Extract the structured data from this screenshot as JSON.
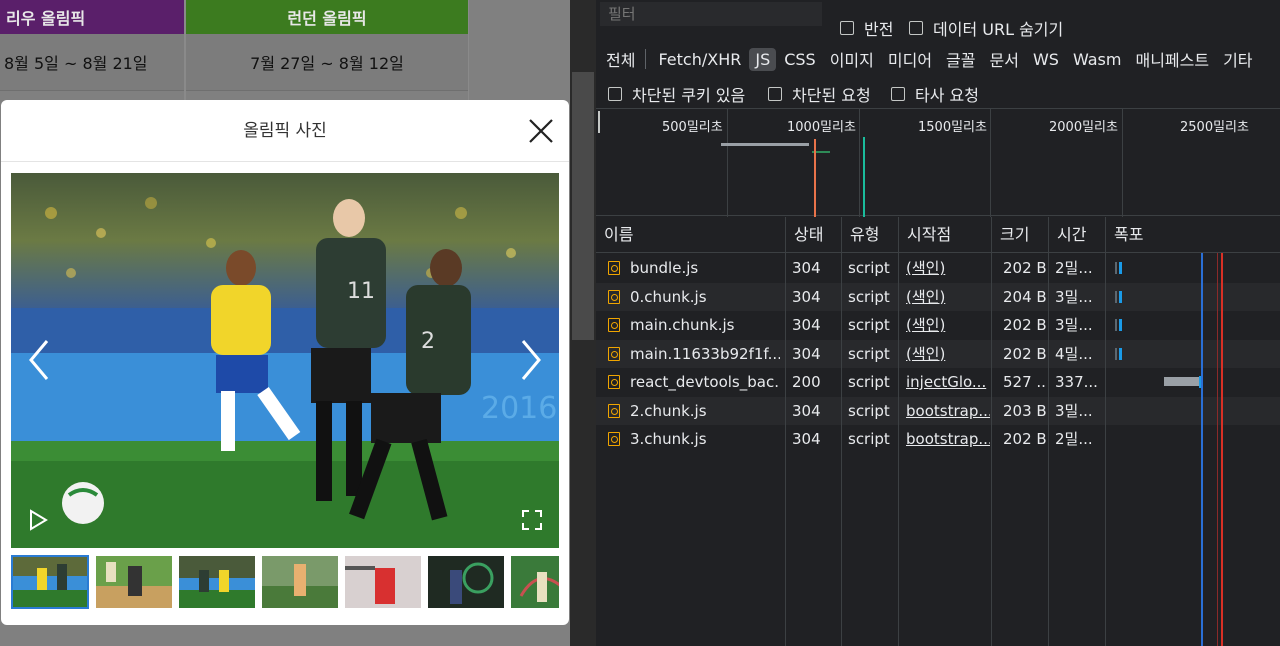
{
  "olympics": {
    "rio": {
      "title": "리우 올림픽",
      "dates": "8월 5일 ~ 8월 21일"
    },
    "london": {
      "title": "런던 올림픽",
      "dates": "7월 27일 ~ 8월 12일"
    }
  },
  "modal": {
    "title": "올림픽 사진",
    "thumbnail_count": 7,
    "active_thumbnail": 1
  },
  "devtools": {
    "filter_placeholder": "필터",
    "invert_label": "반전",
    "hide_data_urls_label": "데이터 URL 숨기기",
    "types": [
      "전체",
      "Fetch/XHR",
      "JS",
      "CSS",
      "이미지",
      "미디어",
      "글꼴",
      "문서",
      "WS",
      "Wasm",
      "매니페스트",
      "기타"
    ],
    "active_type": "JS",
    "blocked_cookies_label": "차단된 쿠키 있음",
    "blocked_requests_label": "차단된 요청",
    "third_party_label": "타사 요청",
    "timeline_labels": [
      "500밀리초",
      "1000밀리초",
      "1500밀리초",
      "2000밀리초",
      "2500밀리초"
    ],
    "columns": [
      "이름",
      "상태",
      "유형",
      "시작점",
      "크기",
      "시간",
      "폭포"
    ],
    "requests": [
      {
        "name": "bundle.js",
        "status": "304",
        "type": "script",
        "initiator": "(색인)",
        "size": "202 B",
        "time": "2밀..."
      },
      {
        "name": "0.chunk.js",
        "status": "304",
        "type": "script",
        "initiator": "(색인)",
        "size": "204 B",
        "time": "3밀..."
      },
      {
        "name": "main.chunk.js",
        "status": "304",
        "type": "script",
        "initiator": "(색인)",
        "size": "202 B",
        "time": "3밀..."
      },
      {
        "name": "main.11633b92f1f...",
        "status": "304",
        "type": "script",
        "initiator": "(색인)",
        "size": "202 B",
        "time": "4밀..."
      },
      {
        "name": "react_devtools_bac...",
        "status": "200",
        "type": "script",
        "initiator": "injectGlo...",
        "size": "527 ...",
        "time": "337..."
      },
      {
        "name": "2.chunk.js",
        "status": "304",
        "type": "script",
        "initiator": "bootstrap...",
        "size": "203 B",
        "time": "3밀..."
      },
      {
        "name": "3.chunk.js",
        "status": "304",
        "type": "script",
        "initiator": "bootstrap...",
        "size": "202 B",
        "time": "2밀..."
      }
    ]
  },
  "colors": {
    "rio_header": "#5a1f6a",
    "london_header": "#3c7b1f",
    "devtools_bg": "#202124",
    "js_icon": "#f0a500",
    "waterfall_blue": "#1a9be8",
    "dom_content_loaded": "#2a6fd6",
    "load_event": "#d93025"
  }
}
